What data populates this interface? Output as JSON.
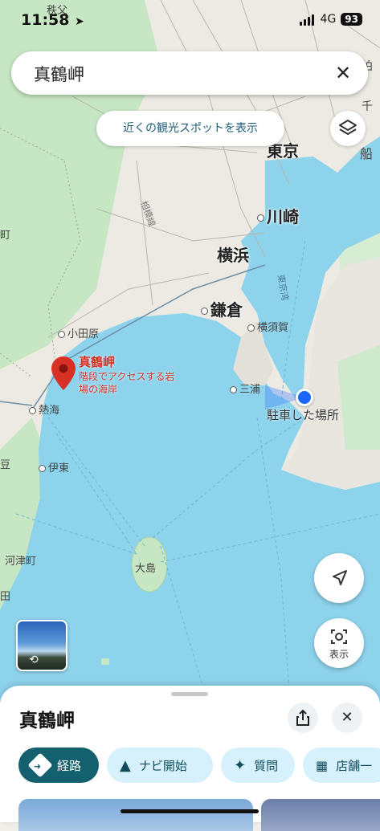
{
  "status_bar": {
    "time": "11:58",
    "network": "4G",
    "battery": "93"
  },
  "search": {
    "query": "真鶴岬"
  },
  "nearby_chip": {
    "label": "近くの観光スポットを表示"
  },
  "map": {
    "places": {
      "chichibu": "秩父",
      "tokyo": "東京",
      "kawasaki": "川崎",
      "yokohama": "横浜",
      "kamakura": "鎌倉",
      "yokosuka": "横須賀",
      "miura": "三浦",
      "odawara": "小田原",
      "atami": "熱海",
      "ito": "伊東",
      "kawazu": "河津町",
      "oshima": "大島",
      "sagami_line": "相模線",
      "tokyo_bay_line": "東京湾",
      "chiba_partial": "千",
      "kashiwa_partial": "柏",
      "funabashi_partial": "船",
      "left_partial_1": "町",
      "left_partial_2": "豆",
      "left_partial_3": "田"
    },
    "pin": {
      "name": "真鶴岬",
      "description_line1": "階段でアクセスする岩",
      "description_line2": "場の海岸"
    },
    "parked_label": "駐車した場所",
    "streetview_label": "表示"
  },
  "sheet": {
    "title": "真鶴岬",
    "actions": [
      {
        "label": "経路"
      },
      {
        "label": "ナビ開始"
      },
      {
        "label": "質問"
      },
      {
        "label": "店舗一"
      }
    ]
  },
  "colors": {
    "water": "#8ed3ec",
    "land": "#eceae3",
    "green": "#c7e6c4",
    "pin": "#d93025",
    "location": "#1a66ff",
    "primary_button": "#14606e"
  }
}
